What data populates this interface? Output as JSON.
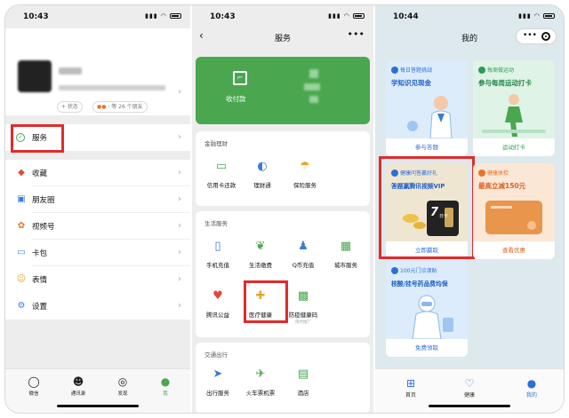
{
  "colors": {
    "wechat_green": "#4aa64f",
    "highlight_red": "#e12b2b",
    "link_blue": "#2d6fd6",
    "orange": "#e8742a"
  },
  "screen1": {
    "time": "10:43",
    "profile": {
      "status_chip": "+ 状态",
      "friends_chip": "· 等 26 个朋友"
    },
    "menu": [
      {
        "label": "服务",
        "icon": "services-icon"
      },
      {
        "label": "收藏",
        "icon": "favorites-cube-icon"
      },
      {
        "label": "朋友圈",
        "icon": "moments-image-icon"
      },
      {
        "label": "视频号",
        "icon": "channels-icon"
      },
      {
        "label": "卡包",
        "icon": "card-wallet-icon"
      },
      {
        "label": "表情",
        "icon": "emoji-icon"
      },
      {
        "label": "设置",
        "icon": "settings-gear-icon"
      }
    ],
    "tabs": [
      {
        "label": "微信",
        "icon": "chat-bubble-icon"
      },
      {
        "label": "通讯录",
        "icon": "contacts-icon"
      },
      {
        "label": "发现",
        "icon": "compass-icon"
      },
      {
        "label": "我",
        "icon": "me-person-icon"
      }
    ]
  },
  "screen2": {
    "time": "10:43",
    "title": "服务",
    "pay_label": "收付款",
    "finance": {
      "title": "金融理财",
      "items": [
        "信用卡还款",
        "理财通",
        "保险服务"
      ]
    },
    "life": {
      "title": "生活服务",
      "items": [
        "手机充值",
        "生活缴费",
        "Q币充值",
        "城市服务",
        "腾讯公益",
        "医疗健康",
        "防疫健康码"
      ],
      "health_code_sub": "限时推广"
    },
    "travel": {
      "title": "交通出行",
      "items": [
        "出行服务",
        "火车票机票",
        "酒店"
      ]
    }
  },
  "screen3": {
    "time": "10:44",
    "title": "我的",
    "cards": [
      {
        "tag": "每日答题挑战",
        "headline": "学知识见现金",
        "cta": "参与答题"
      },
      {
        "tag": "每周做运动",
        "headline": "参与每周运动打卡",
        "cta": "运动打卡"
      },
      {
        "tag": "健康问答赢好礼",
        "headline": "答题赢腾讯视频VIP",
        "cta": "立即赢取",
        "badge": "7",
        "badge_unit": "日卡"
      },
      {
        "tag": "健康体检",
        "headline": "最高立减150元",
        "cta": "查看优惠"
      },
      {
        "tag": "100元门诊津贴",
        "headline": "核酸/挂号药品费均保",
        "cta": "免费领取"
      }
    ],
    "tabs": [
      {
        "label": "首页",
        "icon": "home-icon"
      },
      {
        "label": "健康",
        "icon": "health-heart-icon"
      },
      {
        "label": "我的",
        "icon": "profile-icon"
      }
    ]
  }
}
